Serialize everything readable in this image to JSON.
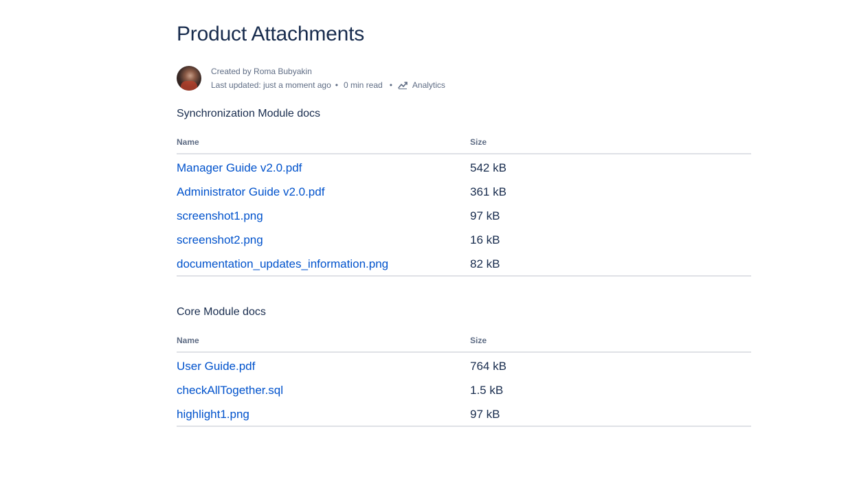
{
  "page": {
    "title": "Product Attachments"
  },
  "byline": {
    "created_by": "Created by Roma Bubyakin",
    "last_updated": "Last updated: just a moment ago",
    "read_time": "0 min read",
    "analytics_label": "Analytics",
    "separator": "•"
  },
  "sections": [
    {
      "title": "Synchronization Module docs",
      "headers": {
        "name": "Name",
        "size": "Size"
      },
      "rows": [
        {
          "name": "Manager Guide v2.0.pdf",
          "size": "542 kB"
        },
        {
          "name": "Administrator Guide v2.0.pdf",
          "size": "361 kB"
        },
        {
          "name": "screenshot1.png",
          "size": "97 kB"
        },
        {
          "name": "screenshot2.png",
          "size": "16 kB"
        },
        {
          "name": "documentation_updates_information.png",
          "size": "82 kB"
        }
      ]
    },
    {
      "title": "Core Module docs",
      "headers": {
        "name": "Name",
        "size": "Size"
      },
      "rows": [
        {
          "name": "User Guide.pdf",
          "size": "764 kB"
        },
        {
          "name": "checkAllTogether.sql",
          "size": "1.5 kB"
        },
        {
          "name": "highlight1.png",
          "size": "97 kB"
        }
      ]
    }
  ],
  "colors": {
    "link": "#0052cc",
    "text": "#172b4d",
    "muted": "#5e6c84",
    "border": "#dfe1e6"
  }
}
